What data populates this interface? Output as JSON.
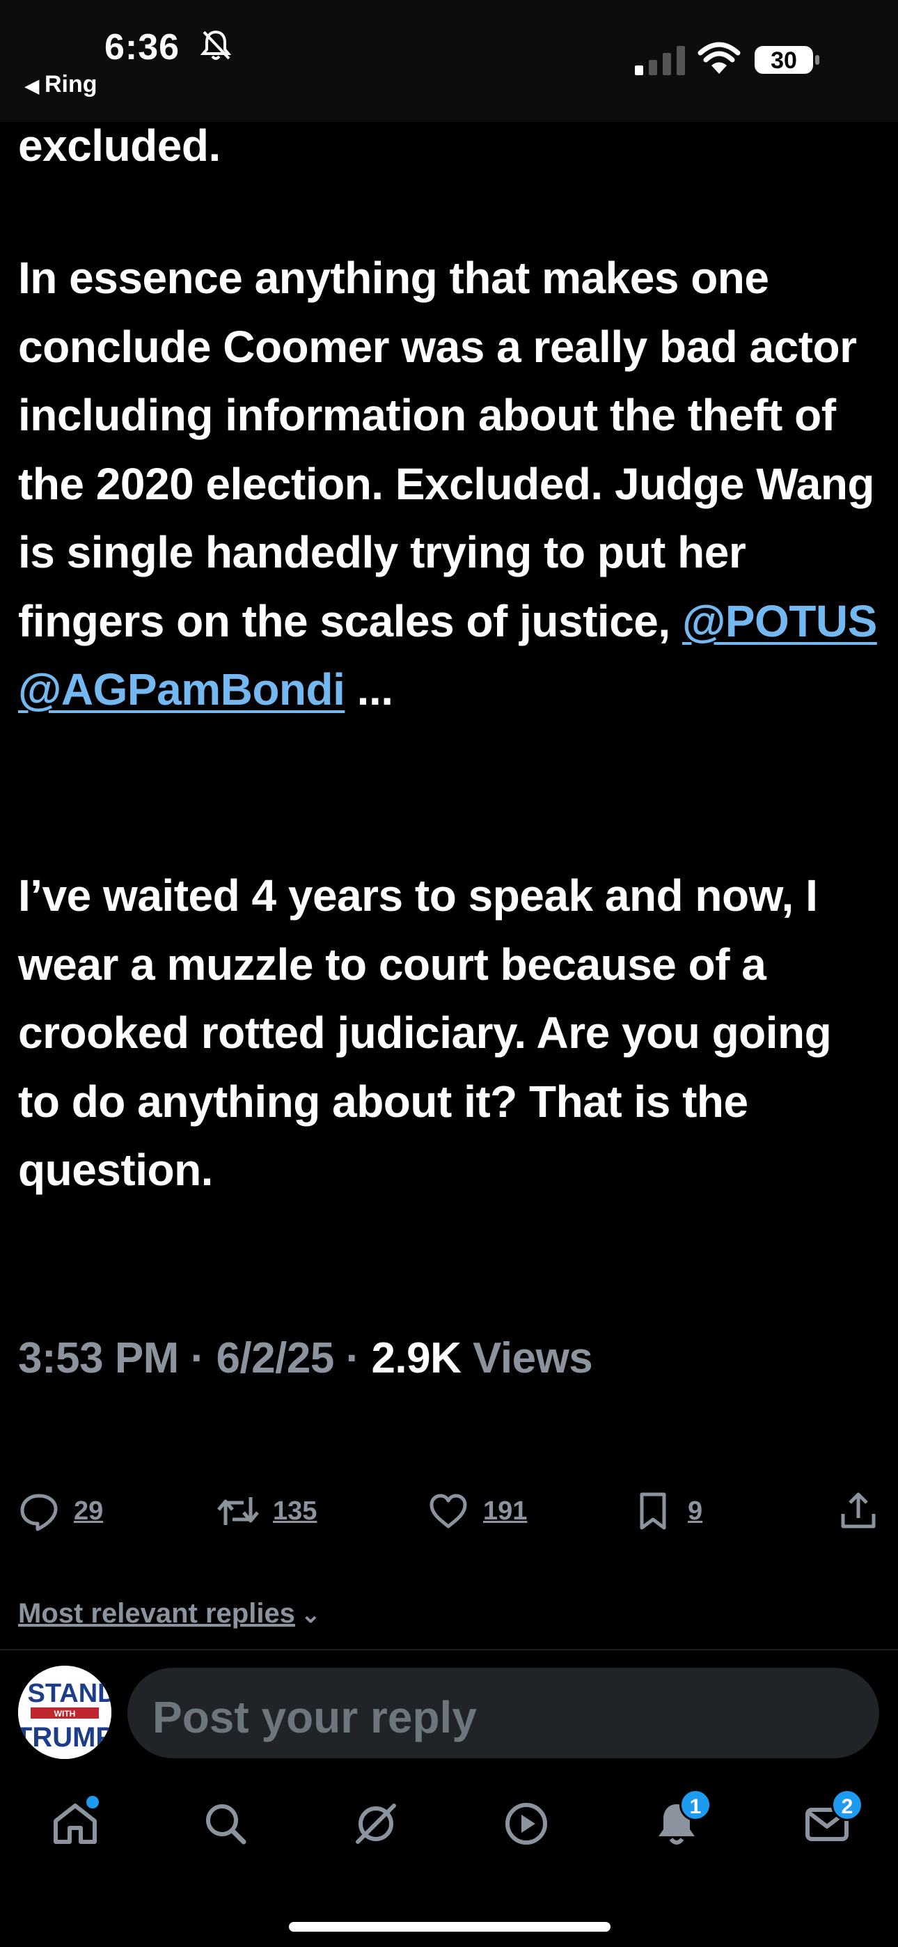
{
  "status_bar": {
    "time": "6:36",
    "back_app": "Ring",
    "battery": "30"
  },
  "tweet": {
    "text_top": "excluded.",
    "paragraph1": "In essence anything that makes one conclude Coomer was a really bad actor including information about the theft of the 2020 election. Excluded. Judge Wang is single handedly trying to put her fingers on the scales of justice,",
    "mention1": "@POTUS",
    "mention2": "@AGPamBondi",
    "ellipsis": "...",
    "paragraph2": "I’ve waited 4 years to speak and now, I wear a muzzle to court because of a crooked rotted judiciary. Are you going to do anything about it? That is the question.",
    "time": "3:53 PM",
    "date": "6/2/25",
    "views_count": "2.9K",
    "views_label": "Views"
  },
  "actions": {
    "replies": "29",
    "reposts": "135",
    "likes": "191",
    "bookmarks": "9"
  },
  "replies_sort": "Most relevant replies",
  "reply_placeholder": "Post your reply",
  "avatar": {
    "line1": "I STAND",
    "line2": "WITH",
    "line3": "TRUMP"
  },
  "tab_bar": {
    "notifications_badge": "1",
    "messages_badge": "2"
  },
  "colors": {
    "accent": "#1d9bf0",
    "mention": "#74b8f2",
    "muted": "#8b949e"
  },
  "icons": [
    "bell-slash-icon",
    "signal-icon",
    "wifi-icon",
    "battery-icon",
    "reply-icon",
    "repost-icon",
    "like-icon",
    "bookmark-icon",
    "share-icon",
    "chevron-down-icon",
    "home-icon",
    "search-icon",
    "grok-icon",
    "video-icon",
    "notifications-icon",
    "messages-icon"
  ]
}
